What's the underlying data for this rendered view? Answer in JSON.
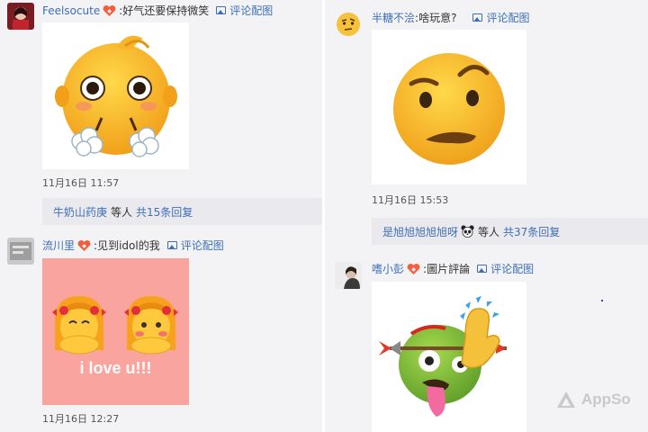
{
  "comments": [
    {
      "user": "Feelsocute",
      "text": "好气还要保持微笑",
      "pic_link": "评论配图",
      "time": "11月16日 11:57",
      "reply": {
        "who": "牛奶山药庚",
        "etc": "等人",
        "count": "共15条回复"
      },
      "image_icon": "huffing-baby-face-emoji"
    },
    {
      "user": "流川里",
      "text": "见到idol的我",
      "pic_link": "评论配图",
      "time": "11月16日 12:27",
      "image_caption": "i love u!!!",
      "image_icon": "two-blushing-girls-emoji",
      "image_bg": "#f9a49e"
    },
    {
      "user": "半糖不浍",
      "text": "啥玩意?",
      "pic_link": "评论配图",
      "time": "11月16日 15:53",
      "reply": {
        "who": "是旭旭旭旭旭呀",
        "etc": "等人",
        "count": "共37条回复"
      },
      "image_icon": "raised-eyebrow-face-emoji"
    },
    {
      "user": "嗜小彭",
      "text": "圖片評論",
      "pic_link": "评论配图",
      "image_icon": "arrow-through-head-raised-hand-emoji"
    }
  ],
  "watermark": "AppSo",
  "colors": {
    "link": "#3e6fb4",
    "background": "#f3f3f5",
    "reply_bg": "#e9e9ee",
    "pink_card": "#f9a49e"
  }
}
